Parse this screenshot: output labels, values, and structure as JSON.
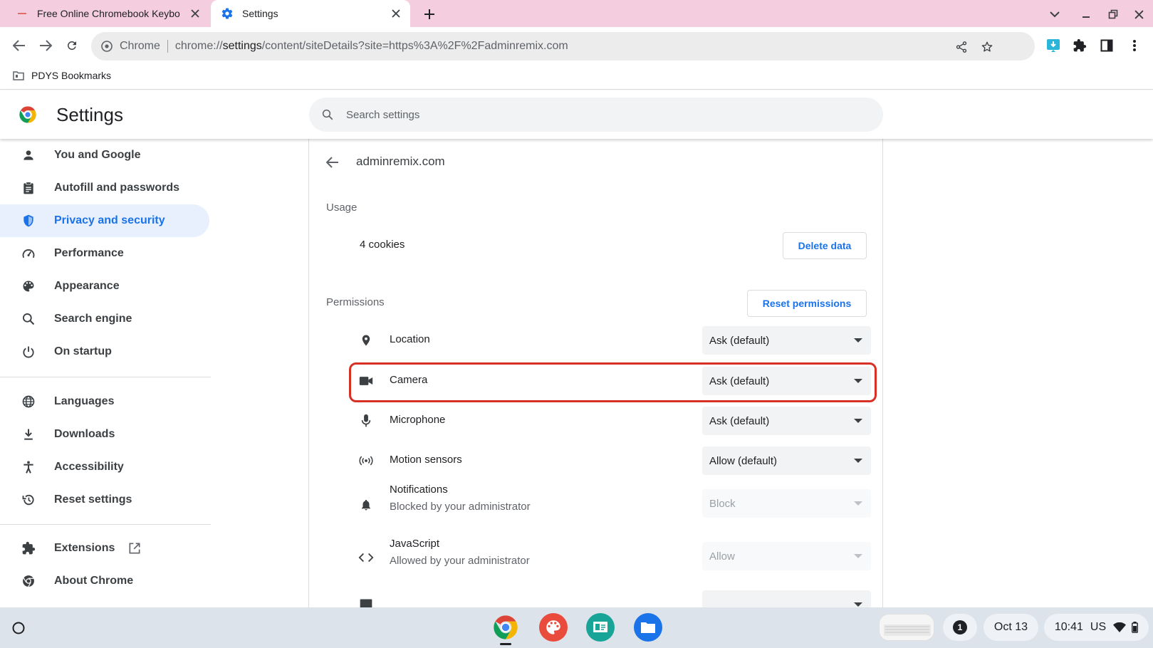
{
  "tabs": [
    {
      "title": "Free Online Chromebook Keybo",
      "active": false
    },
    {
      "title": "Settings",
      "active": true
    }
  ],
  "omnibox": {
    "chip": "Chrome",
    "url_prefix": "chrome://",
    "url_host": "settings",
    "url_path": "/content/siteDetails?site=https%3A%2F%2Fadminremix.com"
  },
  "bookmarks": [
    {
      "label": "PDYS Bookmarks"
    }
  ],
  "header": {
    "title": "Settings",
    "search_placeholder": "Search settings"
  },
  "sidebar": {
    "items": [
      {
        "label": "You and Google",
        "icon": "person-icon"
      },
      {
        "label": "Autofill and passwords",
        "icon": "clipboard-icon"
      },
      {
        "label": "Privacy and security",
        "icon": "shield-icon",
        "active": true
      },
      {
        "label": "Performance",
        "icon": "speedometer-icon"
      },
      {
        "label": "Appearance",
        "icon": "palette-icon"
      },
      {
        "label": "Search engine",
        "icon": "search-icon"
      },
      {
        "label": "On startup",
        "icon": "power-icon"
      },
      {
        "label": "Languages",
        "icon": "globe-icon"
      },
      {
        "label": "Downloads",
        "icon": "download-icon"
      },
      {
        "label": "Accessibility",
        "icon": "accessibility-icon"
      },
      {
        "label": "Reset settings",
        "icon": "history-icon"
      },
      {
        "label": "Extensions",
        "icon": "puzzle-icon"
      },
      {
        "label": "About Chrome",
        "icon": "chrome-icon"
      }
    ]
  },
  "site": {
    "name": "adminremix.com",
    "usage_label": "Usage",
    "cookies": "4 cookies",
    "delete_label": "Delete data",
    "permissions_label": "Permissions",
    "reset_label": "Reset permissions"
  },
  "permissions": [
    {
      "label": "Location",
      "value": "Ask (default)",
      "icon": "location-pin-icon"
    },
    {
      "label": "Camera",
      "value": "Ask (default)",
      "icon": "camera-icon",
      "highlighted": true
    },
    {
      "label": "Microphone",
      "value": "Ask (default)",
      "icon": "microphone-icon"
    },
    {
      "label": "Motion sensors",
      "value": "Allow (default)",
      "icon": "sensors-icon"
    },
    {
      "label": "Notifications",
      "sublabel": "Blocked by your administrator",
      "value": "Block",
      "icon": "bell-icon",
      "disabled": true
    },
    {
      "label": "JavaScript",
      "sublabel": "Allowed by your administrator",
      "value": "Allow",
      "icon": "code-icon",
      "disabled": true
    },
    {
      "label": "",
      "value": "",
      "icon": "image-icon"
    }
  ],
  "shelf": {
    "notification_count": "1",
    "date": "Oct 13",
    "time": "10:41",
    "locale": "US"
  },
  "colors": {
    "accent": "#1a73e8",
    "tab_strip": "#f4cede",
    "highlight_border": "#d93025",
    "active_nav_bg": "#e8f0fe"
  }
}
